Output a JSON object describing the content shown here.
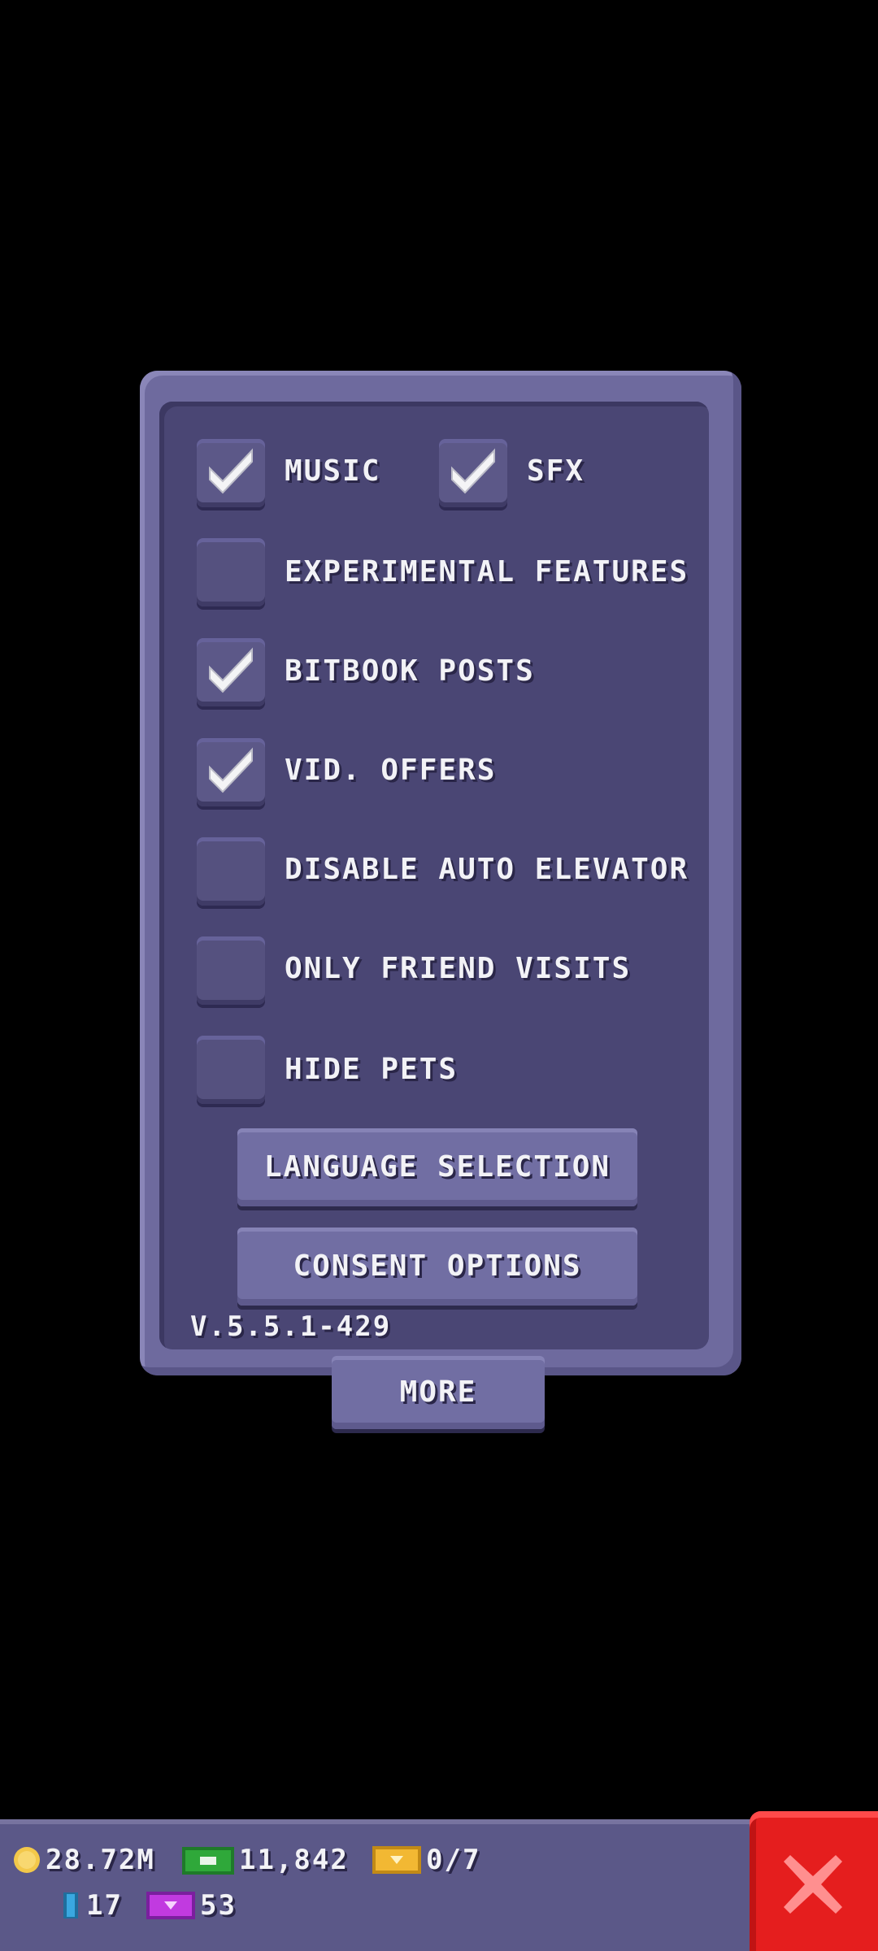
{
  "settings": {
    "options": [
      {
        "label": "MUSIC",
        "checked": true
      },
      {
        "label": "SFX",
        "checked": true
      },
      {
        "label": "EXPERIMENTAL FEATURES",
        "checked": false
      },
      {
        "label": "BITBOOK POSTS",
        "checked": true
      },
      {
        "label": "VID. OFFERS",
        "checked": true
      },
      {
        "label": "DISABLE AUTO ELEVATOR",
        "checked": false
      },
      {
        "label": "ONLY FRIEND VISITS",
        "checked": false
      },
      {
        "label": "HIDE PETS",
        "checked": false
      }
    ],
    "language_button": "LANGUAGE SELECTION",
    "consent_button": "CONSENT OPTIONS",
    "version": "V.5.5.1-429",
    "more_button": "MORE"
  },
  "status_bar": {
    "coins": "28.72M",
    "bux": "11,842",
    "tickets": "0/7",
    "keys": "17",
    "vip": "53"
  },
  "colors": {
    "background": "#000000",
    "panel": "#6e6a9e",
    "panel_inner": "#4a4674",
    "button": "#716ea3",
    "close_red": "#e51e1e",
    "coin": "#f3c84a",
    "bux_green": "#2fa83a",
    "ticket_gold": "#f2b833",
    "key_blue": "#3aa8e0",
    "vip_purple": "#c13ae0"
  },
  "icons": {
    "checkmark": "check-icon",
    "coin": "coin-icon",
    "bux": "bux-icon",
    "ticket": "ticket-icon",
    "key": "key-icon",
    "vip": "vip-icon",
    "close": "close-icon"
  }
}
